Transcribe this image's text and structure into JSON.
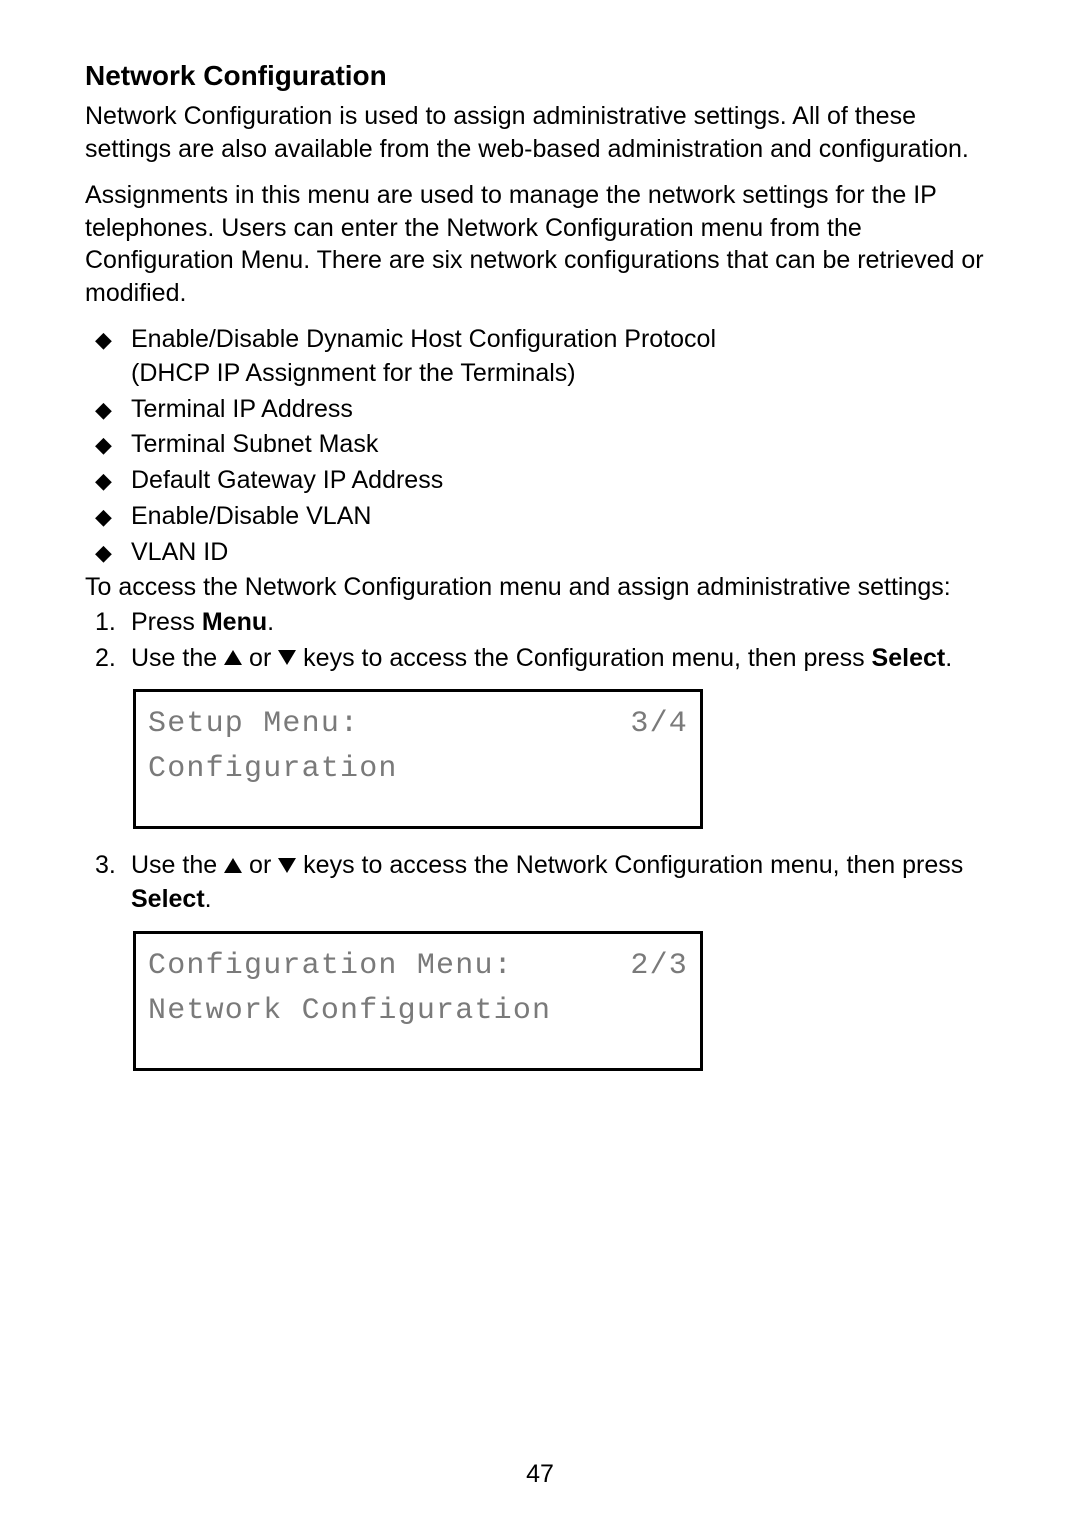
{
  "heading": "Network Configuration",
  "para1": "Network Configuration is used to assign administrative settings. All of these settings are also available from the web-based administration and configuration.",
  "para2": "Assignments in this menu are used to manage the network settings for the IP telephones. Users can enter the Network Configuration menu from the Configuration Menu. There are six network configurations that can be retrieved or modified.",
  "bullets": {
    "b1_line1": "Enable/Disable Dynamic Host Configuration Protocol",
    "b1_line2": "(DHCP IP Assignment for the Terminals)",
    "b2": "Terminal IP Address",
    "b3": "Terminal Subnet Mask",
    "b4": "Default Gateway IP Address",
    "b5": "Enable/Disable VLAN",
    "b6": "VLAN ID"
  },
  "para3": "To access the Network Configuration menu and assign administrative settings:",
  "steps": {
    "s1_num": "1.",
    "s1_prefix": "Press ",
    "s1_bold": "Menu",
    "s1_suffix": ".",
    "s2_num": "2.",
    "s2_prefix": "Use the ",
    "s2_mid": " or ",
    "s2_aftermid": " keys to access the Configuration menu, then press ",
    "s2_bold": "Select",
    "s2_suffix": ".",
    "s3_num": "3.",
    "s3_prefix": "Use the ",
    "s3_mid": " or ",
    "s3_aftermid": " keys to access the Network Configuration menu, then press ",
    "s3_bold": "Select",
    "s3_suffix": "."
  },
  "lcd1": {
    "line1_left": "Setup Menu:",
    "line1_right": "3/4",
    "line2": "Configuration"
  },
  "lcd2": {
    "line1_left": "Configuration Menu:",
    "line1_right": "2/3",
    "line2": "Network Configuration"
  },
  "page_number": "47"
}
